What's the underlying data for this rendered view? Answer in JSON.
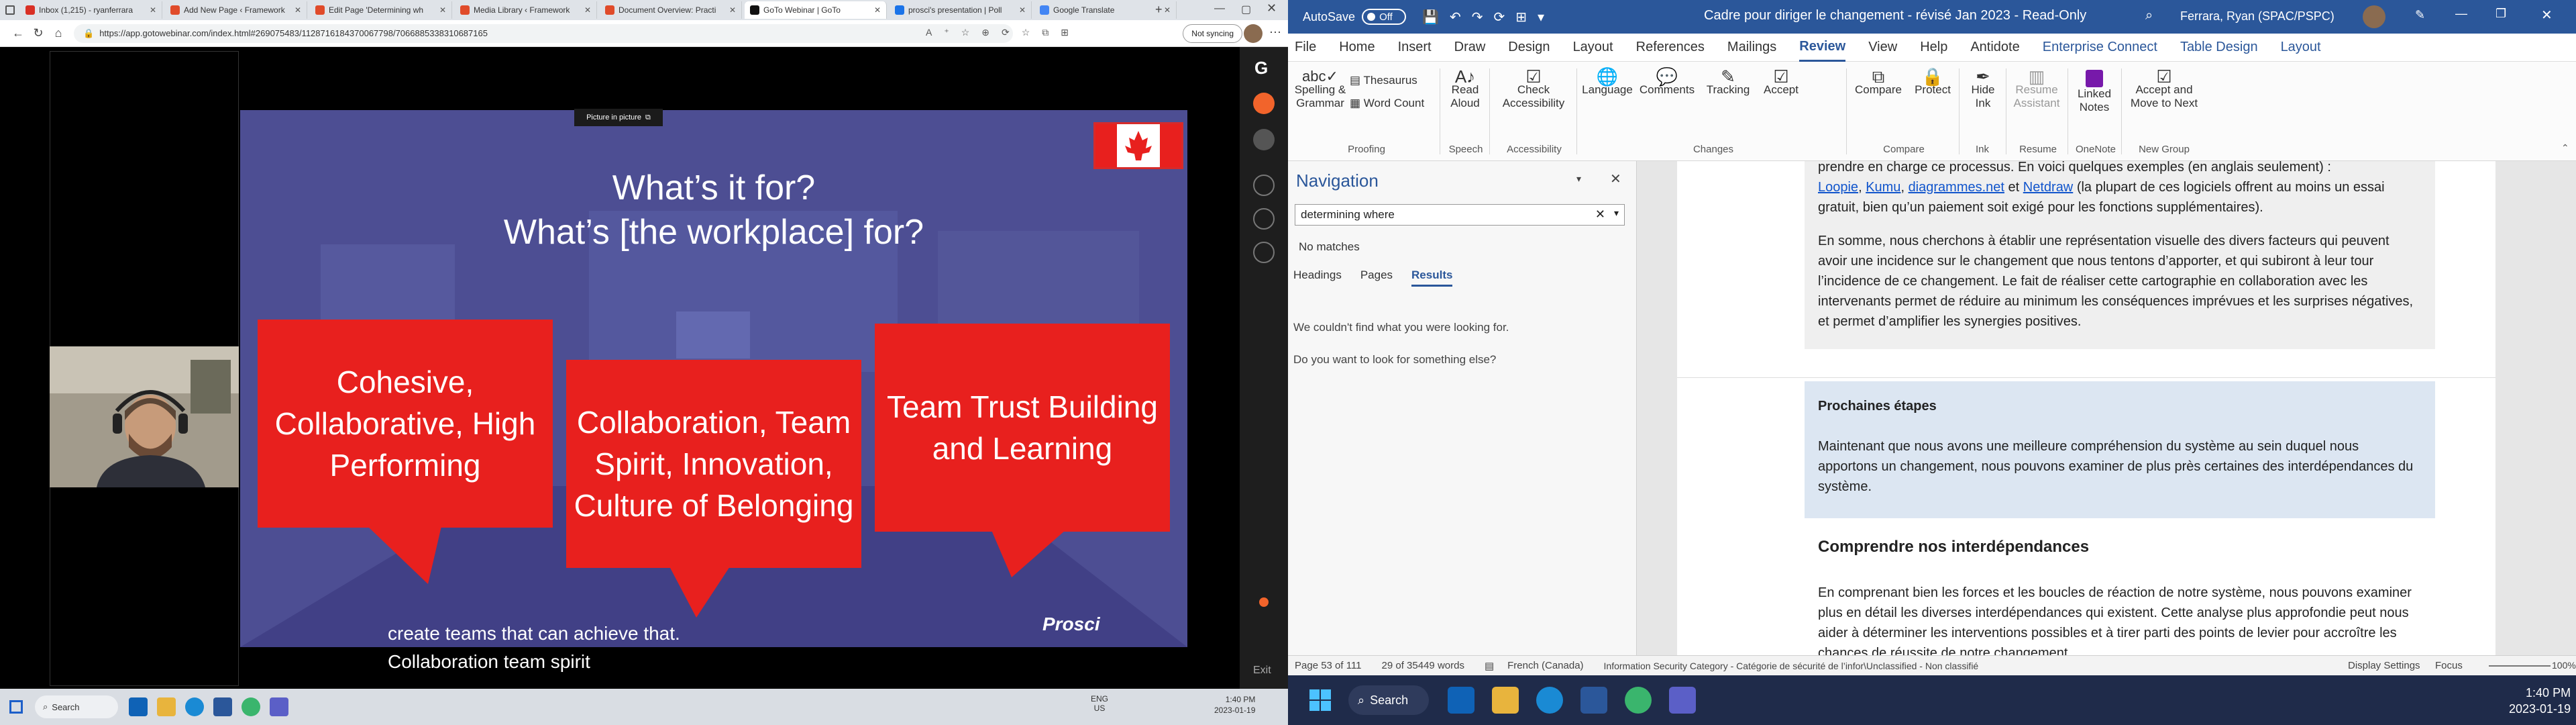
{
  "browser": {
    "tabs": [
      {
        "label": "Inbox (1,215) - ryanferrara",
        "color": "#d93025"
      },
      {
        "label": "Add New Page ‹ Framework",
        "color": "#e04b2a"
      },
      {
        "label": "Edit Page 'Determining wh",
        "color": "#e04b2a"
      },
      {
        "label": "Media Library ‹ Framework",
        "color": "#e04b2a"
      },
      {
        "label": "Document Overview: Practi",
        "color": "#e04b2a"
      },
      {
        "label": "GoTo Webinar | GoTo",
        "color": "#111111"
      },
      {
        "label": "prosci's presentation | Poll",
        "color": "#1a73e8"
      },
      {
        "label": "Google Translate",
        "color": "#4285f4"
      }
    ],
    "url": "https://app.gotowebinar.com/index.html#269075483/1128716184370067798/7066885338310687165",
    "sync_label": "Not syncing"
  },
  "webinar": {
    "pip_label": "Picture in picture",
    "slide": {
      "title_line1": "What’s it for?",
      "title_line2": "What’s [the workplace] for?",
      "bubble1": "Cohesive, Collaborative, High Performing",
      "bubble2": "Collaboration, Team Spirit, Innovation, Culture of Belonging",
      "bubble3": "Team Trust Building and Learning",
      "logo": "Prosci"
    },
    "caption_line1": "create teams that can achieve that.",
    "caption_line2": "Collaboration team spirit",
    "exit_label": "Exit"
  },
  "taskbar_left": {
    "search_label": "Search",
    "lang_top": "ENG",
    "lang_bottom": "US",
    "time": "1:40 PM",
    "date": "2023-01-19"
  },
  "word": {
    "autosave_label": "AutoSave",
    "autosave_state": "Off",
    "doc_title": "Cadre pour diriger le changement - révisé Jan 2023  -  Read-Only",
    "user_name": "Ferrara, Ryan (SPAC/PSPC)",
    "menu": [
      "File",
      "Home",
      "Insert",
      "Draw",
      "Design",
      "Layout",
      "References",
      "Mailings",
      "Review",
      "View",
      "Help",
      "Antidote",
      "Enterprise Connect",
      "Table Design",
      "Layout"
    ],
    "menu_selected_index": 8,
    "ribbon": {
      "spelling": "Spelling & Grammar",
      "thesaurus": "Thesaurus",
      "wordcount": "Word Count",
      "readaloud": "Read Aloud",
      "checkacc": "Check Accessibility",
      "language": "Language",
      "comments": "Comments",
      "tracking": "Tracking",
      "accept": "Accept",
      "compare": "Compare",
      "protect": "Protect",
      "hideink": "Hide Ink",
      "resume": "Resume Assistant",
      "linked": "Linked Notes",
      "acceptmove": "Accept and Move to Next",
      "groups": [
        "Proofing",
        "Speech",
        "Accessibility",
        "Changes",
        "Compare",
        "Ink",
        "Resume",
        "OneNote",
        "New Group"
      ]
    },
    "nav": {
      "title": "Navigation",
      "search_value": "determining where",
      "no_matches": "No matches",
      "tabs": [
        "Headings",
        "Pages",
        "Results"
      ],
      "msg1": "We couldn't find what you were looking for.",
      "msg2": "Do you want to look for something else?"
    },
    "doc": {
      "p1_line1": "prendre en charge ce processus. En voici quelques exemples (en anglais seulement) :",
      "link1": "Loopie",
      "link2": "Kumu",
      "link3": "diagrammes.net",
      "et": "et",
      "link4": "Netdraw",
      "p1_rest": "(la plupart de ces logiciels offrent au moins un essai gratuit, bien qu’un paiement soit exigé pour les fonctions supplémentaires).",
      "p2": "En somme, nous cherchons à établir une représentation visuelle des divers facteurs qui peuvent avoir une incidence sur le changement que nous tentons d’apporter, et qui subiront à leur tour l’incidence de ce changement. Le fait de réaliser cette cartographie en collaboration avec les intervenants permet de réduire au minimum les conséquences imprévues et les surprises négatives, et permet d’amplifier les synergies positives.",
      "box_title": "Prochaines étapes",
      "box_text": "Maintenant que nous avons une meilleure compréhension du système au sein duquel nous apportons un changement, nous pouvons examiner de plus près certaines des interdépendances du système.",
      "h2": "Comprendre nos interdépendances",
      "p3": "En comprenant bien les forces et les boucles de réaction de notre système, nous pouvons examiner plus en détail les diverses interdépendances qui existent. Cette analyse plus approfondie peut nous aider à déterminer les interventions possibles et à tirer parti des points de levier pour accroître les chances de réussite de notre changement."
    },
    "status": {
      "page": "Page 53 of 111",
      "words": "29 of 35449 words",
      "lang": "French (Canada)",
      "category": "Information Security Category - Catégorie de sécurité de l’infor\\Unclassified - Non classifié",
      "display": "Display Settings",
      "focus": "Focus",
      "zoom": "100%"
    }
  },
  "taskbar_right": {
    "search_label": "Search",
    "time": "1:40 PM",
    "date": "2023-01-19"
  },
  "colors": {
    "word_blue": "#2b579a",
    "slide_red": "#e8201e",
    "slide_bg": "#4d4e93"
  }
}
